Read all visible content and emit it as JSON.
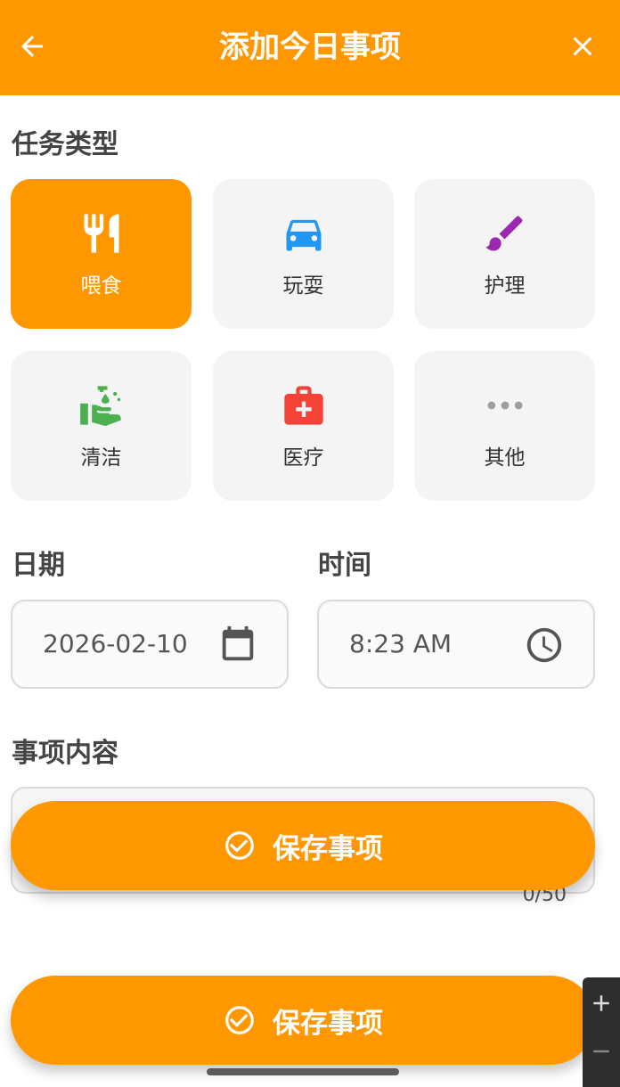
{
  "header": {
    "title": "添加今日事项",
    "back_icon": "arrow-left-icon",
    "close_icon": "close-icon"
  },
  "task_type": {
    "label": "任务类型",
    "selected": "喂食",
    "items": [
      {
        "label": "喂食",
        "icon": "utensils-icon",
        "color": "#FFFFFF",
        "active": true
      },
      {
        "label": "玩耍",
        "icon": "toy-car-icon",
        "color": "#2196F3",
        "active": false
      },
      {
        "label": "护理",
        "icon": "brush-icon",
        "color": "#9C27B0",
        "active": false
      },
      {
        "label": "清洁",
        "icon": "hand-wash-icon",
        "color": "#4CAF50",
        "active": false
      },
      {
        "label": "医疗",
        "icon": "medical-kit-icon",
        "color": "#F44336",
        "active": false
      },
      {
        "label": "其他",
        "icon": "more-icon",
        "color": "#9E9E9E",
        "active": false
      }
    ]
  },
  "date": {
    "label": "日期",
    "value": "2026-02-10",
    "icon": "calendar-icon"
  },
  "time": {
    "label": "时间",
    "value": "8:23 AM",
    "icon": "clock-icon"
  },
  "content": {
    "label": "事项内容",
    "value": "",
    "counter": "0/50"
  },
  "save_floating": {
    "label": "保存事项",
    "icon": "check-circle-icon"
  },
  "save_bottom": {
    "label": "保存事项",
    "icon": "check-circle-icon"
  },
  "colors": {
    "accent": "#FF9800",
    "card_bg": "#F4F4F4"
  }
}
